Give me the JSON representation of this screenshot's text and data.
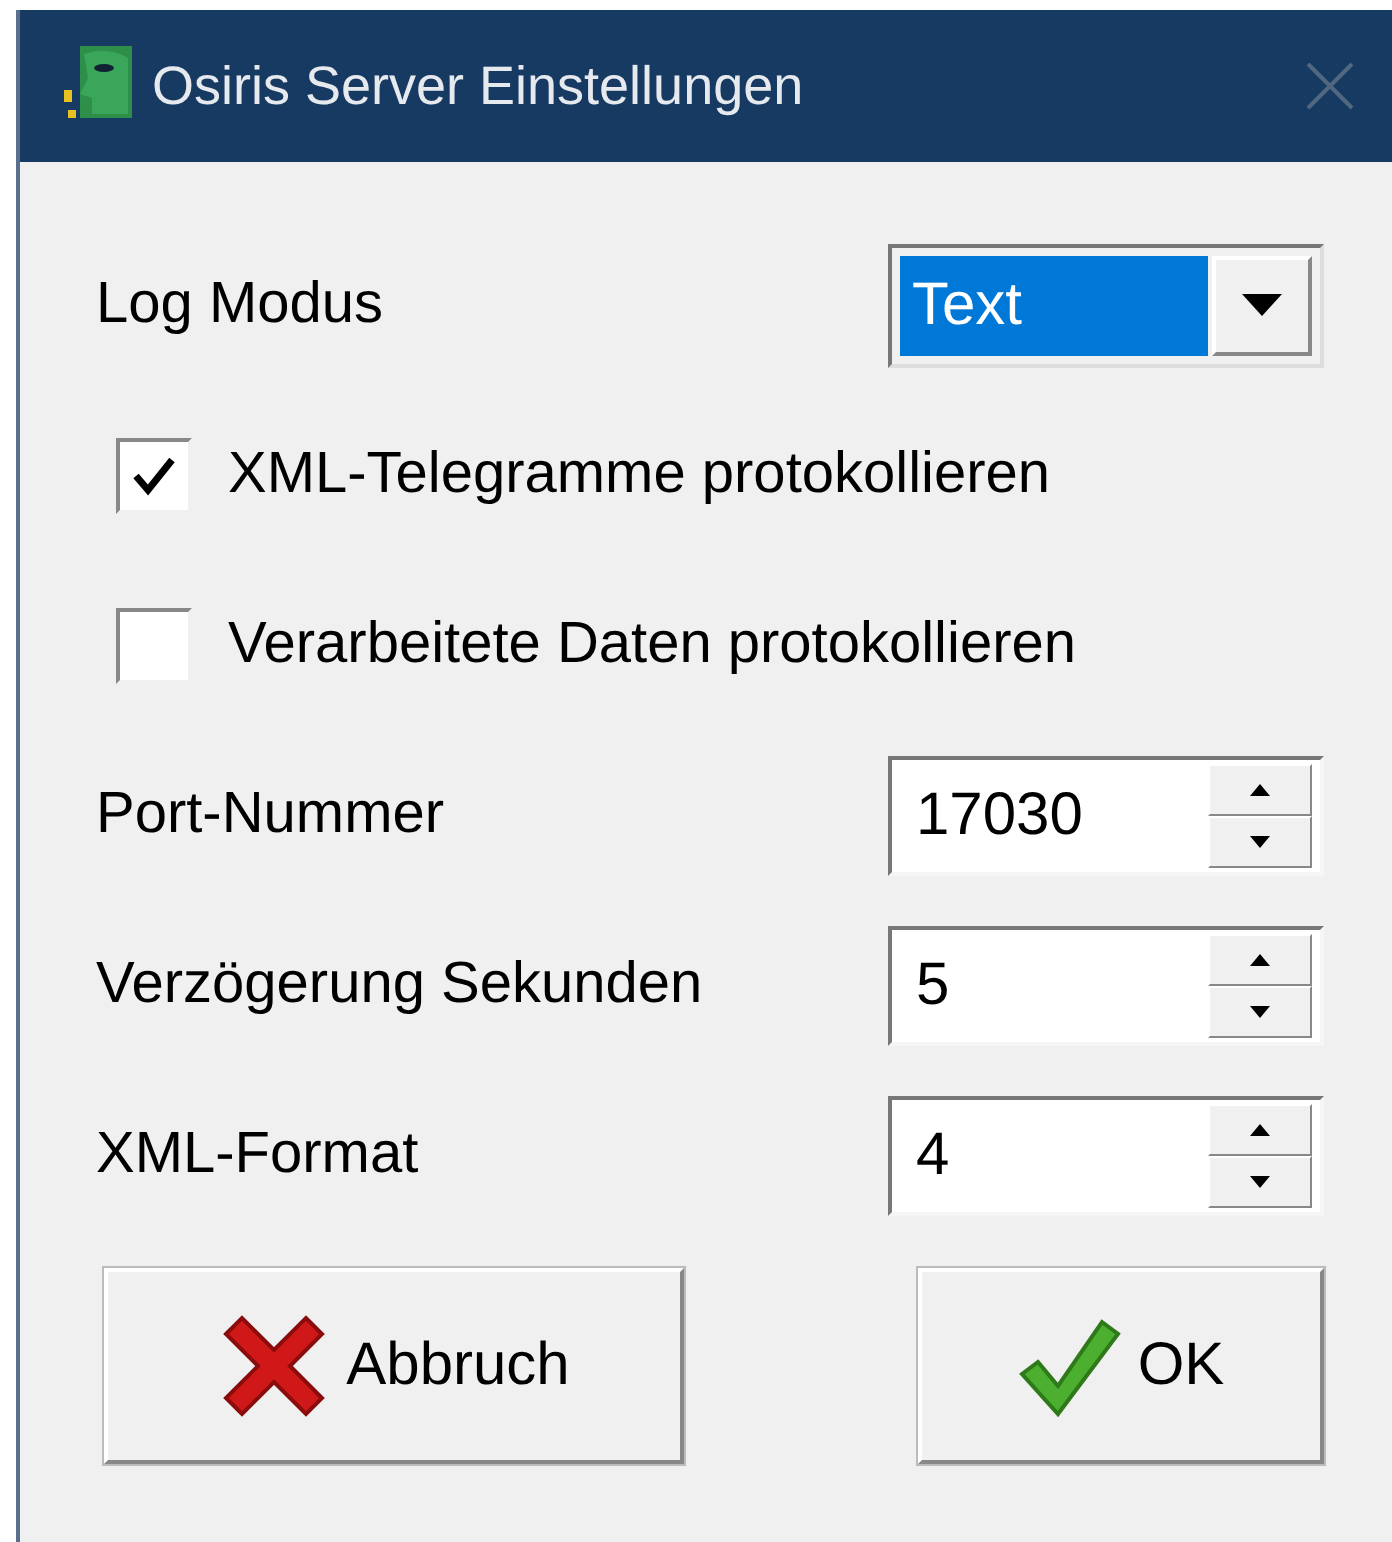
{
  "window": {
    "title": "Osiris Server Einstellungen"
  },
  "fields": [
    {
      "kind": "combo",
      "label": "Log Modus",
      "value": "Text"
    },
    {
      "kind": "checkbox",
      "label": "XML-Telegramme protokollieren",
      "checked": true
    },
    {
      "kind": "checkbox",
      "label": "Verarbeitete Daten protokollieren",
      "checked": false
    },
    {
      "kind": "spin",
      "label": "Port-Nummer",
      "value": "17030"
    },
    {
      "kind": "spin",
      "label": "Verzögerung Sekunden",
      "value": "5"
    },
    {
      "kind": "spin",
      "label": "XML-Format",
      "value": "4"
    }
  ],
  "buttons": [
    {
      "kind": "cancel",
      "label": "Abbruch"
    },
    {
      "kind": "ok",
      "label": "OK"
    }
  ]
}
